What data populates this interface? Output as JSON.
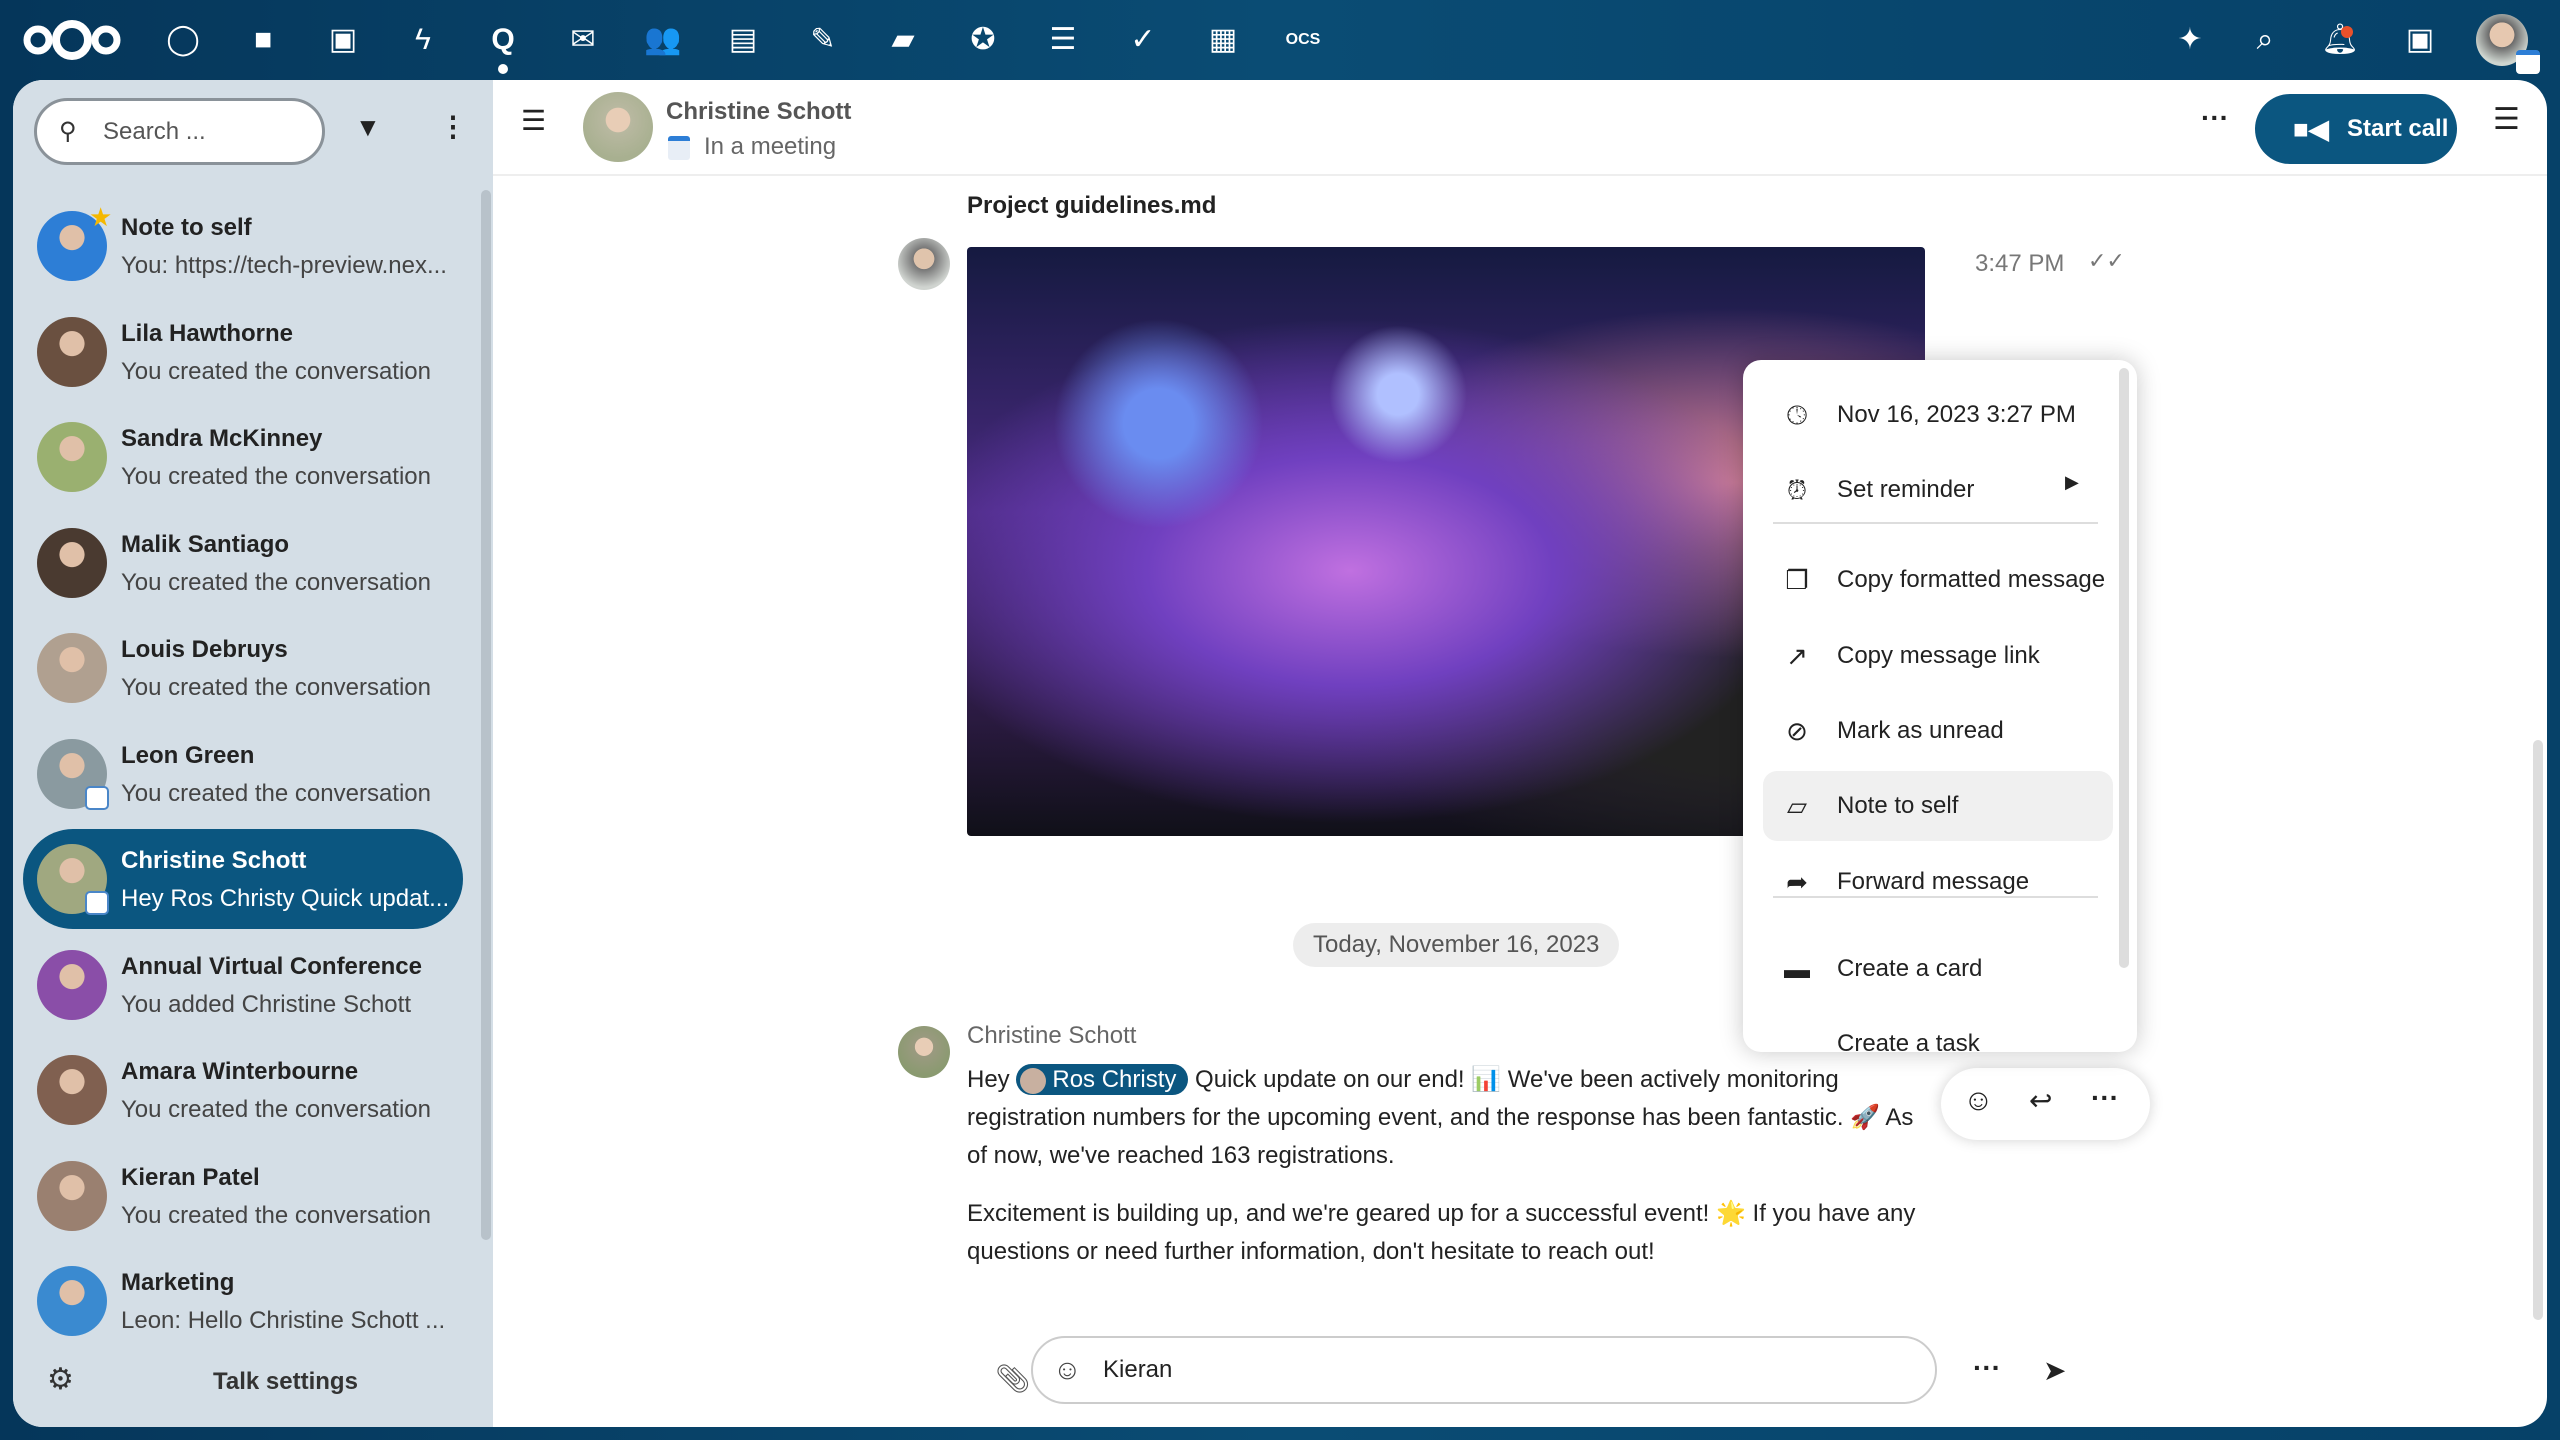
{
  "topbar": {
    "apps": [
      "dashboard-icon",
      "files-icon",
      "photos-icon",
      "activity-icon",
      "talk-icon",
      "mail-icon",
      "contacts-icon",
      "calendar-icon",
      "notes-icon",
      "deck-icon",
      "circles-icon",
      "tasks-icon",
      "check-icon",
      "tables-icon",
      "ocs-icon"
    ],
    "right": [
      "assistant-icon",
      "search-icon",
      "notifications-icon",
      "contacts-menu-icon",
      "user-avatar"
    ]
  },
  "sidebar": {
    "search_placeholder": "Search ...",
    "settings_label": "Talk settings",
    "conversations": [
      {
        "name": "Note to self",
        "sub": "You: https://tech-preview.nex...",
        "color": "#2d7ed6"
      },
      {
        "name": "Lila Hawthorne",
        "sub": "You created the conversation",
        "color": "#6a5040"
      },
      {
        "name": "Sandra McKinney",
        "sub": "You created the conversation",
        "color": "#9ab070"
      },
      {
        "name": "Malik Santiago",
        "sub": "You created the conversation",
        "color": "#4a3a30"
      },
      {
        "name": "Louis Debruys",
        "sub": "You created the conversation",
        "color": "#b0a090"
      },
      {
        "name": "Leon Green",
        "sub": "You created the conversation",
        "color": "#8a9aa0"
      },
      {
        "name": "Christine Schott",
        "sub": "Hey Ros Christy Quick updat...",
        "color": "#a0a880"
      },
      {
        "name": "Annual Virtual Conference",
        "sub": "You added Christine Schott",
        "color": "#8a4ea8"
      },
      {
        "name": "Amara Winterbourne",
        "sub": "You created the conversation",
        "color": "#806050"
      },
      {
        "name": "Kieran Patel",
        "sub": "You created the conversation",
        "color": "#9a8070"
      },
      {
        "name": "Marketing",
        "sub": "Leon: Hello Christine Schott ...",
        "color": "#3a8ad0"
      }
    ]
  },
  "header": {
    "name": "Christine Schott",
    "status": "In a meeting",
    "start_call": "Start call"
  },
  "chat": {
    "file_name": "Project guidelines.md",
    "file_time": "3:47 PM",
    "date_separator": "Today, November 16, 2023",
    "author": "Christine Schott",
    "mention": "Ros Christy",
    "p1_a": "Hey ",
    "p1_b": " Quick update on our end! 📊 We've been actively monitoring registration numbers for the upcoming event, and the response has been fantastic. 🚀 As of now, we've reached 163 registrations.",
    "p2": "Excitement is building up, and we're geared up for a successful event! 🌟 If you have any questions or need further information, don't hesitate to reach out!"
  },
  "menu": {
    "items": [
      {
        "label": "Nov 16, 2023 3:27 PM",
        "icon": "clock-icon"
      },
      {
        "label": "Set reminder",
        "icon": "alarm-icon"
      },
      {
        "label": "Copy formatted message",
        "icon": "copy-icon"
      },
      {
        "label": "Copy message link",
        "icon": "open-link-icon"
      },
      {
        "label": "Mark as unread",
        "icon": "eye-off-icon"
      },
      {
        "label": "Note to self",
        "icon": "note-icon"
      },
      {
        "label": "Forward message",
        "icon": "forward-icon"
      },
      {
        "label": "Create a card",
        "icon": "deck-icon"
      },
      {
        "label": "Create a task",
        "icon": "task-icon"
      }
    ]
  },
  "composer": {
    "value": "Kieran"
  },
  "colors": {
    "primary": "#0b5680",
    "topbar": "#05365a",
    "sidebar": "#d4dee6"
  }
}
